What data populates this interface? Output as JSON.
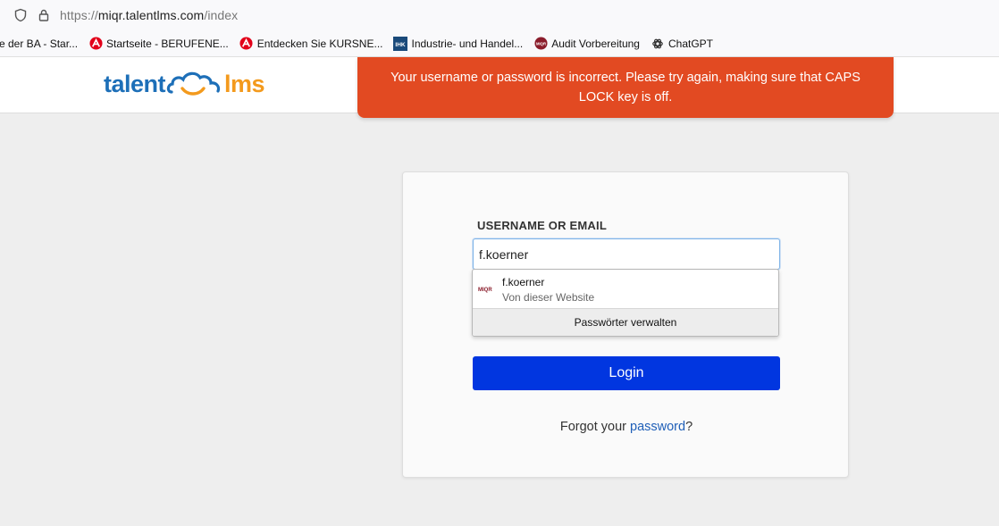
{
  "browser": {
    "url_prefix": "https://",
    "url_host": "miqr.talentlms.com",
    "url_path": "/index",
    "bookmarks": [
      {
        "label": "e der BA - Star..."
      },
      {
        "label": "Startseite - BERUFENE..."
      },
      {
        "label": "Entdecken Sie KURSNE..."
      },
      {
        "label": "Industrie- und Handel..."
      },
      {
        "label": "Audit Vorbereitung"
      },
      {
        "label": "ChatGPT"
      }
    ],
    "bookmark_icons": {
      "arbeitsagentur_color": "#e2001a",
      "ihk_color": "#1a4a7a",
      "miqr_color": "#8a1c2b",
      "ihk_text": "IHK",
      "miqr_text": "MIQR"
    }
  },
  "header": {
    "logo_left": "talent",
    "logo_right": "lms",
    "brand_blue": "#1d6fb8",
    "brand_orange": "#f39a1d"
  },
  "toast": {
    "message": "Your username or password is incorrect. Please try again, making sure that CAPS LOCK key is off.",
    "color": "#e24a22"
  },
  "login": {
    "username_label": "USERNAME OR EMAIL",
    "username_value": "f.koerner",
    "button_label": "Login",
    "button_color": "#0136e0",
    "forgot_prefix": "Forgot your ",
    "forgot_link": "password",
    "forgot_suffix": "?"
  },
  "autocomplete": {
    "favicon_text": "MIQR",
    "username": "f.koerner",
    "source": "Von dieser Website",
    "manage_label": "Passwörter verwalten"
  }
}
